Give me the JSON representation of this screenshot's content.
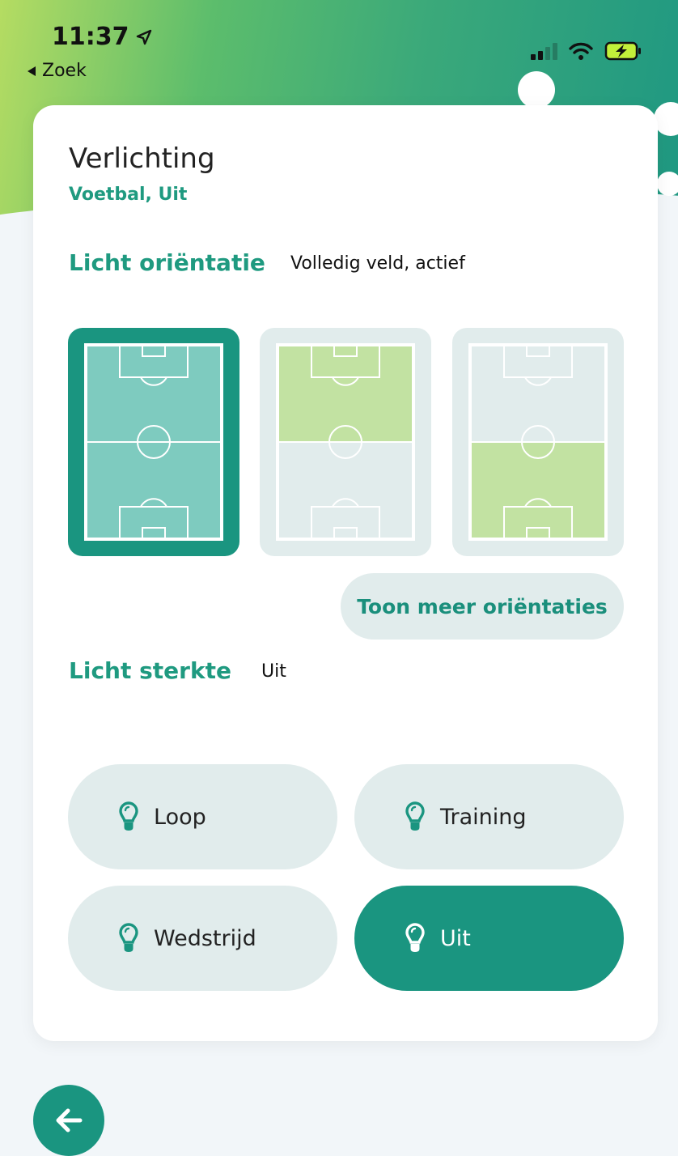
{
  "status_bar": {
    "time": "11:37",
    "back_app_label": "Zoek"
  },
  "header": {
    "title": "Verlichting",
    "subtitle": "Voetbal, Uit"
  },
  "orientation": {
    "label": "Licht oriëntatie",
    "value": "Volledig veld, actief",
    "options": [
      {
        "id": "full-field",
        "selected": true
      },
      {
        "id": "top-half",
        "selected": false
      },
      {
        "id": "bottom-half",
        "selected": false
      }
    ],
    "more_button": "Toon meer oriëntaties"
  },
  "strength": {
    "label": "Licht sterkte",
    "value": "Uit",
    "modes": [
      {
        "label": "Loop",
        "selected": false
      },
      {
        "label": "Training",
        "selected": false
      },
      {
        "label": "Wedstrijd",
        "selected": false
      },
      {
        "label": "Uit",
        "selected": true
      }
    ]
  },
  "icons": {
    "location": "location-arrow-icon",
    "back_small": "triangle-left-icon",
    "signal": "cellular-signal-icon",
    "wifi": "wifi-icon",
    "battery": "battery-charging-icon",
    "bulb": "lightbulb-icon",
    "back_fab": "arrow-left-icon"
  },
  "colors": {
    "accent": "#1a9580",
    "accent_text": "#1f9a80",
    "tile_bg": "#e1ecec",
    "lit_green": "#c2e2a2",
    "field_selected": "#7ecbbf"
  }
}
